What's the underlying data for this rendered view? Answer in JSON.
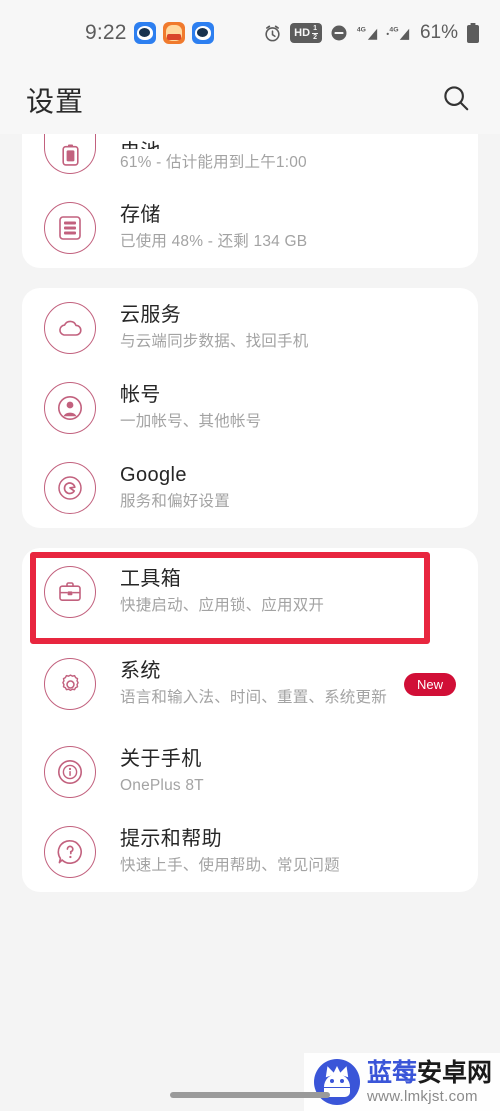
{
  "statusbar": {
    "time": "9:22",
    "app_icons": [
      "chat-app-icon",
      "food-app-icon",
      "chat-app-icon"
    ],
    "alarm_icon": "alarm-icon",
    "volte_label": "HD",
    "volte_frac_top": "1",
    "volte_frac_bottom": "2",
    "dnd_icon": "do-not-disturb-icon",
    "signal1_label": "4G",
    "signal2_label": "4G",
    "battery_percent": "61%",
    "battery_icon": "battery-icon"
  },
  "header": {
    "title": "设置",
    "search_icon": "search-icon"
  },
  "cards": [
    {
      "id": "card-status",
      "clipped_top": true,
      "rows": [
        {
          "id": "battery",
          "icon": "battery-outline-icon",
          "title": "电池",
          "subtitle": "61% - 估计能用到上午1:00",
          "clipped": true,
          "badge": null
        },
        {
          "id": "storage",
          "icon": "storage-icon",
          "title": "存储",
          "subtitle": "已使用 48% - 还剩 134 GB",
          "clipped": false,
          "badge": null
        }
      ]
    },
    {
      "id": "card-accounts",
      "clipped_top": false,
      "rows": [
        {
          "id": "cloud-service",
          "icon": "cloud-icon",
          "title": "云服务",
          "subtitle": "与云端同步数据、找回手机",
          "clipped": false,
          "badge": null
        },
        {
          "id": "account",
          "icon": "account-icon",
          "title": "帐号",
          "subtitle": "一加帐号、其他帐号",
          "clipped": false,
          "badge": null
        },
        {
          "id": "google",
          "icon": "google-icon",
          "title": "Google",
          "subtitle": "服务和偏好设置",
          "clipped": false,
          "badge": null
        }
      ]
    },
    {
      "id": "card-system",
      "clipped_top": false,
      "rows": [
        {
          "id": "toolbox",
          "icon": "toolbox-icon",
          "title": "工具箱",
          "subtitle": "快捷启动、应用锁、应用双开",
          "clipped": false,
          "badge": null,
          "highlighted": true
        },
        {
          "id": "system",
          "icon": "gear-icon",
          "title": "系统",
          "subtitle": "语言和输入法、时间、重置、系统更新",
          "clipped": false,
          "badge": "New"
        },
        {
          "id": "about-phone",
          "icon": "info-icon",
          "title": "关于手机",
          "subtitle": "OnePlus 8T",
          "clipped": false,
          "badge": null
        },
        {
          "id": "tips-and-support",
          "icon": "help-icon",
          "title": "提示和帮助",
          "subtitle": "快速上手、使用帮助、常见问题",
          "clipped": false,
          "badge": null
        }
      ]
    }
  ],
  "watermark": {
    "logo_icon": "android-mascot-icon",
    "brand_part1": "蓝莓",
    "brand_part2": "安卓网",
    "url": "www.lmkjst.com"
  },
  "colors": {
    "accent_icon": "#c2617e",
    "highlight": "#e8263f",
    "badge": "#d10f37",
    "title_text": "#262626",
    "subtitle_text": "#a3a3a3",
    "page_bg": "#f4f4f4",
    "card_bg": "#ffffff",
    "watermark_blue": "#3a55d8"
  }
}
